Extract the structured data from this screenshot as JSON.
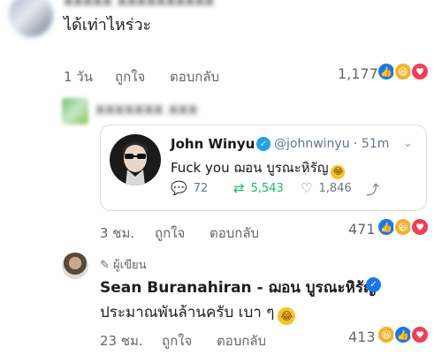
{
  "comment1": {
    "text": "ได้เท่าไหร่วะ",
    "time": "1 วัน",
    "like_label": "ถูกใจ",
    "reply_label": "ตอบกลับ",
    "reaction_count": "1,177",
    "reactions": [
      "like",
      "haha",
      "love"
    ]
  },
  "tweet": {
    "name": "John Winyu",
    "handle": "@johnwinyu · 51m",
    "text": "Fuck you ฌอน บูรณะหิรัญ",
    "replies": "72",
    "retweets": "5,543",
    "likes": "1,846",
    "retweet_color": "#17bf63"
  },
  "comment2": {
    "time": "3 ชม.",
    "like_label": "ถูกใจ",
    "reply_label": "ตอบกลับ",
    "reaction_count": "471",
    "reactions": [
      "like",
      "haha",
      "love"
    ]
  },
  "comment3": {
    "author_tag": "ผู้เขียน",
    "name": "Sean Buranahiran - ฌอน บูรณะหิรัญ",
    "text": "ประมาณพันล้านครับ เบา ๆ",
    "time": "23 ชม.",
    "like_label": "ถูกใจ",
    "reply_label": "ตอบกลับ",
    "reaction_count": "413",
    "reactions": [
      "haha",
      "like",
      "love"
    ]
  },
  "colors": {
    "facebook_blue": "#1877f2",
    "twitter_blue": "#1da1f2",
    "meta_gray": "#65676b"
  }
}
